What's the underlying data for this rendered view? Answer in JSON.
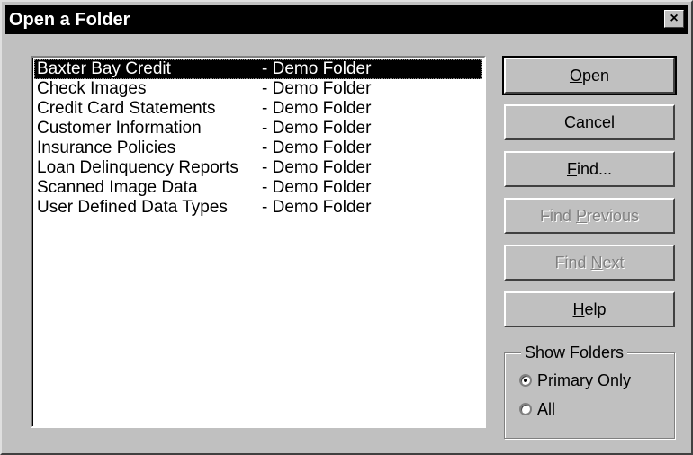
{
  "window": {
    "title": "Open a Folder",
    "close_label": "×"
  },
  "folders": [
    {
      "name": "Baxter Bay Credit",
      "type": "- Demo Folder",
      "selected": true
    },
    {
      "name": "Check Images",
      "type": "- Demo Folder",
      "selected": false
    },
    {
      "name": "Credit Card Statements",
      "type": "- Demo Folder",
      "selected": false
    },
    {
      "name": "Customer Information",
      "type": "- Demo Folder",
      "selected": false
    },
    {
      "name": "Insurance Policies",
      "type": "- Demo Folder",
      "selected": false
    },
    {
      "name": "Loan Delinquency Reports",
      "type": "- Demo Folder",
      "selected": false
    },
    {
      "name": "Scanned Image Data",
      "type": "- Demo Folder",
      "selected": false
    },
    {
      "name": "User Defined Data Types",
      "type": "- Demo Folder",
      "selected": false
    }
  ],
  "buttons": {
    "open": {
      "mnemonic": "O",
      "rest": "pen"
    },
    "cancel": {
      "mnemonic": "C",
      "rest": "ancel"
    },
    "find": {
      "mnemonic": "F",
      "rest": "ind..."
    },
    "find_previous": {
      "pre": "Find ",
      "mnemonic": "P",
      "rest": "revious",
      "disabled": true
    },
    "find_next": {
      "pre": "Find ",
      "mnemonic": "N",
      "rest": "ext",
      "disabled": true
    },
    "help": {
      "mnemonic": "H",
      "rest": "elp"
    }
  },
  "show_folders": {
    "legend": "Show Folders",
    "options": [
      {
        "label": "Primary Only",
        "checked": true
      },
      {
        "label": "All",
        "checked": false
      }
    ]
  }
}
